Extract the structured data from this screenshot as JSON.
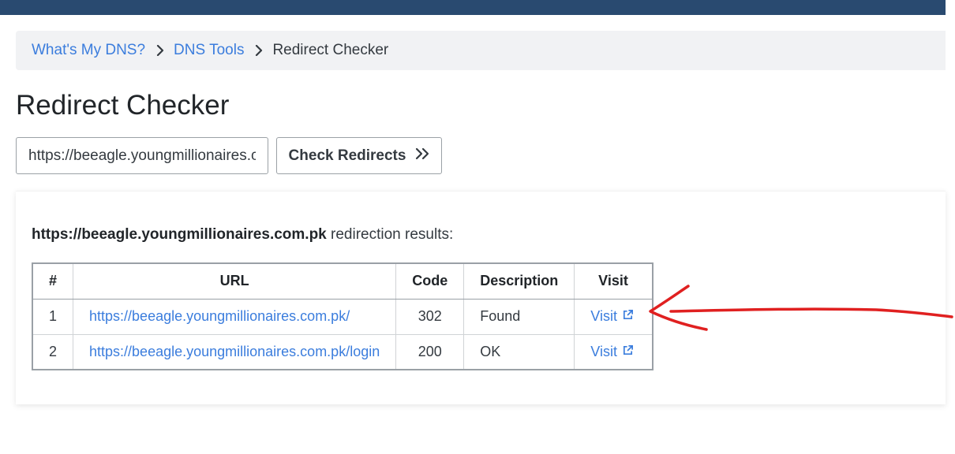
{
  "breadcrumb": {
    "items": [
      "What's My DNS?",
      "DNS Tools"
    ],
    "current": "Redirect Checker"
  },
  "page": {
    "title": "Redirect Checker"
  },
  "form": {
    "url_value": "https://beeagle.youngmillionaires.com.pk",
    "check_button_label": "Check Redirects",
    "check_button_icon": "double-chevron-right-icon"
  },
  "results": {
    "domain": "https://beeagle.youngmillionaires.com.pk",
    "suffix": "redirection results:",
    "columns": [
      "#",
      "URL",
      "Code",
      "Description",
      "Visit"
    ],
    "rows": [
      {
        "num": "1",
        "url": "https://beeagle.youngmillionaires.com.pk/",
        "code": "302",
        "description": "Found",
        "visit": "Visit"
      },
      {
        "num": "2",
        "url": "https://beeagle.youngmillionaires.com.pk/login",
        "code": "200",
        "description": "OK",
        "visit": "Visit"
      }
    ]
  },
  "colors": {
    "topbar": "#294a70",
    "link": "#3b7ddd",
    "annotation": "#e02020"
  }
}
